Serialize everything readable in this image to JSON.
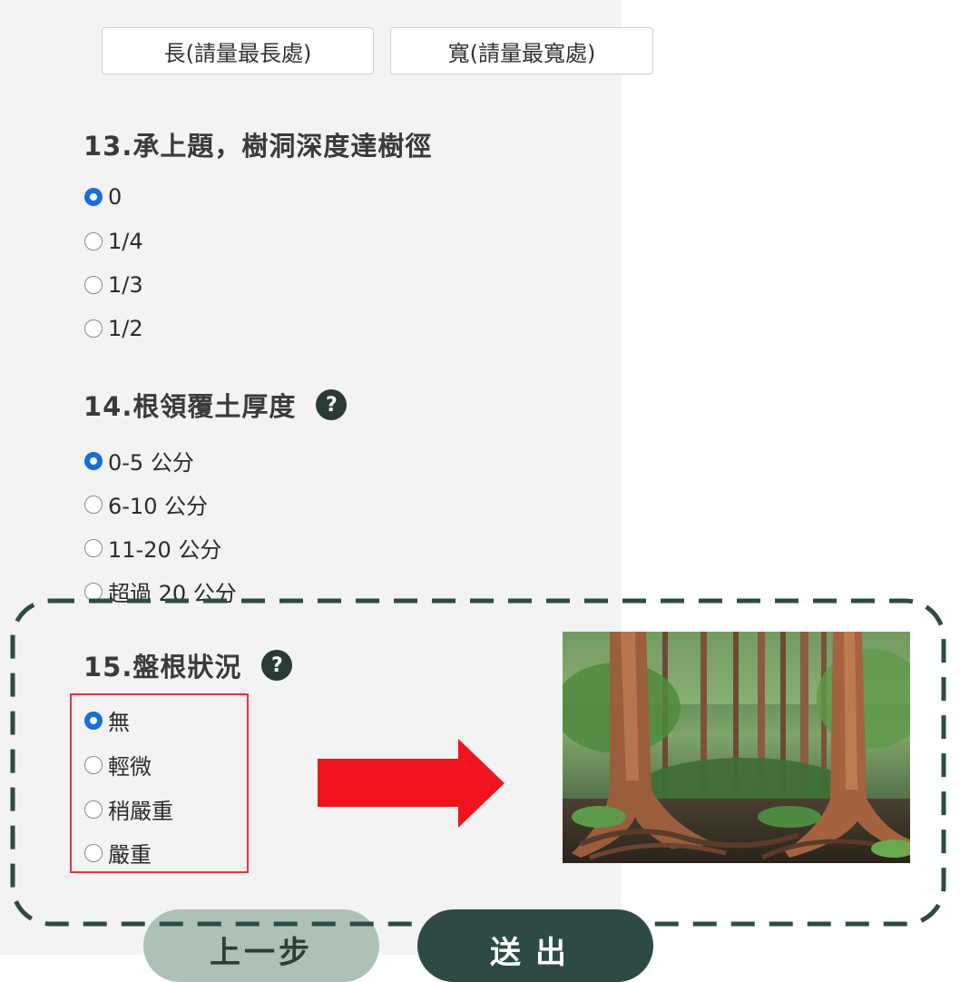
{
  "fields": {
    "length_placeholder": "長(請量最長處)",
    "width_placeholder": "寬(請量最寬處)"
  },
  "q13": {
    "title": "13.承上題，樹洞深度達樹徑",
    "options": [
      "0",
      "1/4",
      "1/3",
      "1/2"
    ],
    "selected": "0"
  },
  "q14": {
    "title": "14.根領覆土厚度",
    "options": [
      "0-5 公分",
      "6-10 公分",
      "11-20 公分",
      "超過 20 公分"
    ],
    "selected": "0-5 公分"
  },
  "q15": {
    "title": "15.盤根狀況",
    "options": [
      "無",
      "輕微",
      "稍嚴重",
      "嚴重"
    ],
    "selected": "無"
  },
  "help_glyph": "?",
  "buttons": {
    "prev": "上一步",
    "submit": "送出"
  },
  "colors": {
    "radio_checked": "#1a6fd8",
    "help_icon_bg": "#2b3a37",
    "highlight_border": "#e8323c",
    "arrow": "#f0141e",
    "dashed_outline": "#2e4a44",
    "prev_button": "#adc1b4",
    "submit_button": "#2e4a44"
  },
  "icons": [
    "help-icon",
    "right-arrow-icon"
  ]
}
